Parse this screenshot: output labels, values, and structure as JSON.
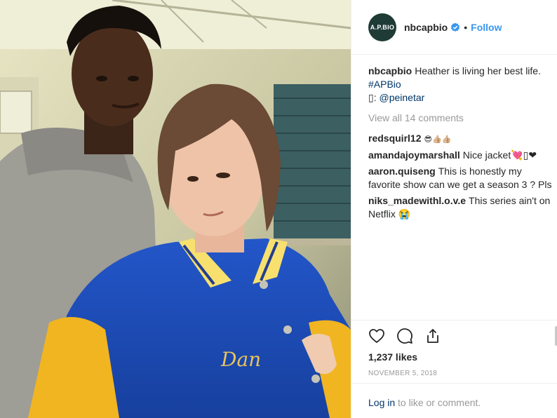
{
  "header": {
    "avatar_text": "A.P.BIO",
    "username": "nbcapbio",
    "separator": "•",
    "follow_label": "Follow"
  },
  "photo": {
    "jacket_text": "Dan"
  },
  "caption": {
    "username": "nbcapbio",
    "text": "Heather is living her best life.",
    "hashtag": "#APBio",
    "credit_prefix": "▯: ",
    "credit_handle": "@peinetar"
  },
  "view_all_label": "View all 14 comments",
  "comments": [
    {
      "username": "redsquirl12",
      "text": "😎👍🏼👍🏼"
    },
    {
      "username": "amandajoymarshall",
      "text": "Nice jacket💘▯❤"
    },
    {
      "username": "aaron.quiseng",
      "text": "This is honestly my favorite show can we get a season 3 ? Pls"
    },
    {
      "username": "niks_madewithl.o.v.e",
      "text": "This series ain't on Netflix 😭"
    }
  ],
  "likes_label": "1,237 likes",
  "date_label": "NOVEMBER 5, 2018",
  "login": {
    "link_label": "Log in",
    "rest_label": "to like or comment."
  },
  "icons": [
    "heart-icon",
    "comment-icon",
    "share-icon",
    "verified-badge-icon"
  ],
  "colors": {
    "link_blue": "#3897f0",
    "dark_link": "#003569",
    "muted": "#999999",
    "avatar_bg": "#1f3b36"
  }
}
